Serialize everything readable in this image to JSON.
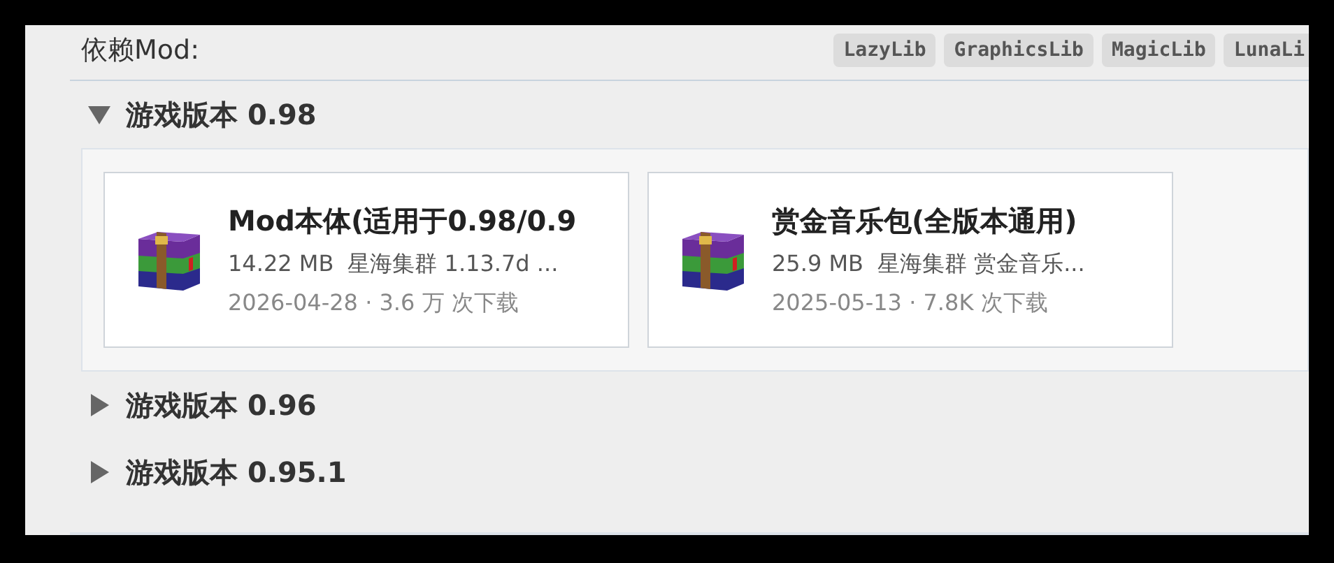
{
  "dependencies": {
    "label": "依赖Mod:",
    "tags": [
      "LazyLib",
      "GraphicsLib",
      "MagicLib",
      "LunaLi"
    ]
  },
  "versions": [
    {
      "title": "游戏版本 0.98",
      "expanded": true,
      "files": [
        {
          "name": "Mod本体(适用于0.98/0.9",
          "size": "14.22 MB",
          "description": "星海集群 1.13.7d ...",
          "meta": "2026-04-28 · 3.6 万 次下载"
        },
        {
          "name": "赏金音乐包(全版本通用)",
          "size": "25.9 MB",
          "description": "星海集群 赏金音乐...",
          "meta": "2025-05-13 · 7.8K 次下载"
        }
      ]
    },
    {
      "title": "游戏版本 0.96",
      "expanded": false
    },
    {
      "title": "游戏版本 0.95.1",
      "expanded": false
    }
  ]
}
